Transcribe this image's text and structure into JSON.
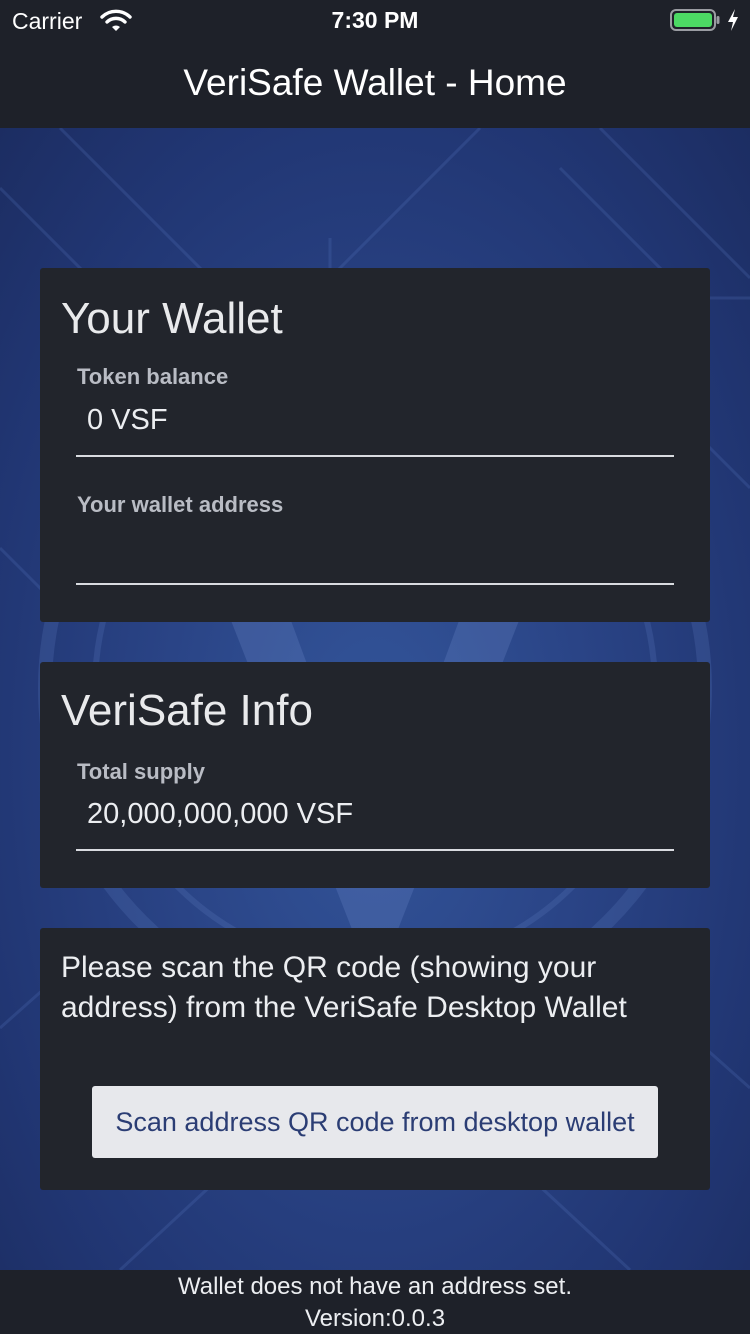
{
  "status_bar": {
    "carrier": "Carrier",
    "time": "7:30 PM",
    "icons": [
      "wifi-icon",
      "battery-icon",
      "charging-bolt-icon"
    ],
    "battery_color": "#4cd964"
  },
  "nav": {
    "title": "VeriSafe Wallet - Home"
  },
  "wallet_card": {
    "title": "Your Wallet",
    "token_balance_label": "Token balance",
    "token_balance_value": "0 VSF",
    "address_label": "Your wallet address",
    "address_value": ""
  },
  "info_card": {
    "title": "VeriSafe Info",
    "total_supply_label": "Total supply",
    "total_supply_value": "20,000,000,000 VSF"
  },
  "scan_card": {
    "instruction": "Please scan the QR code (showing your address) from the VeriSafe Desktop Wallet",
    "button_label": "Scan address QR code from desktop wallet"
  },
  "footer": {
    "status_text": "Wallet does not have an address set.",
    "version_text": "Version:0.0.3"
  },
  "colors": {
    "bar_background": "#1e2129",
    "card_background": "#22252c",
    "background_blue": "#2a4486",
    "button_background": "#e7e8ec",
    "button_text": "#2b3d74"
  }
}
